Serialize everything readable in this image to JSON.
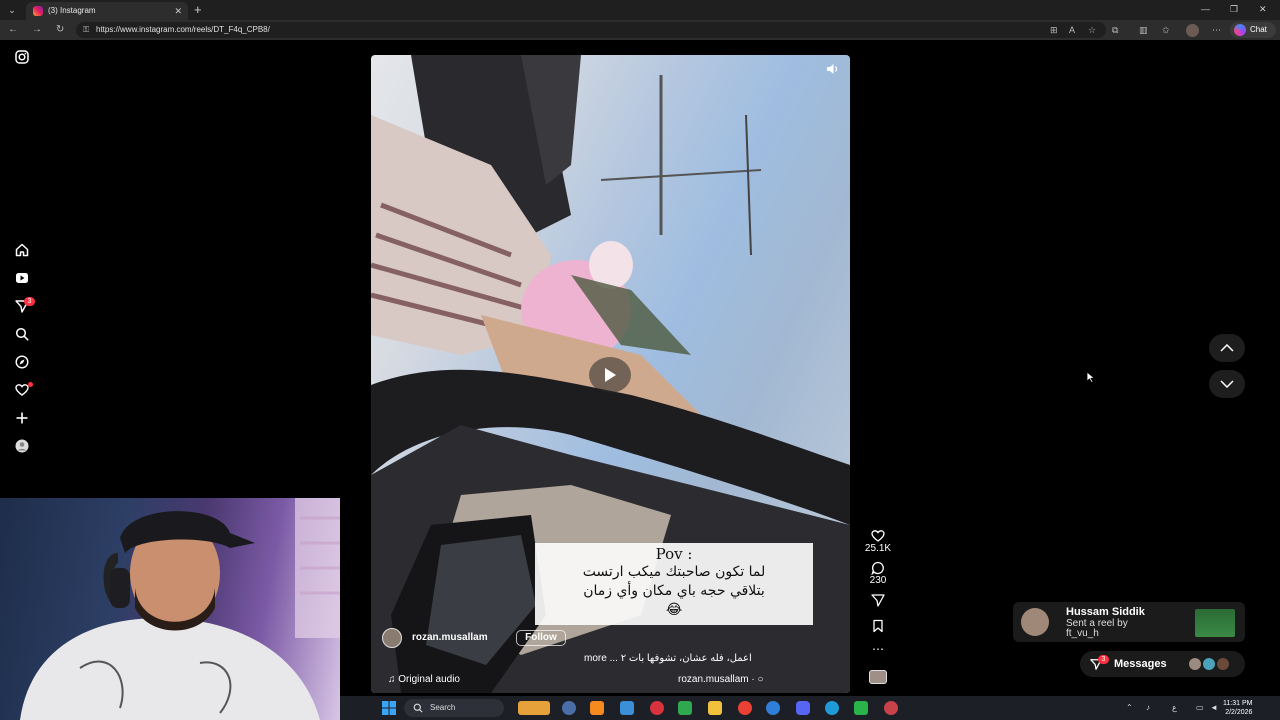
{
  "browser": {
    "tab_title": "(3) Instagram",
    "url": "https://www.instagram.com/reels/DT_F4q_CPB8/",
    "chat_label": "Chat"
  },
  "sidebar": {
    "notifications_badge": "3"
  },
  "reel": {
    "caption_pov": "Pov :",
    "caption_line1": "لما تكون صاحبتك ميكب ارتست",
    "caption_line2": "بتلاقي حجه باي مكان وأي زمان",
    "caption_emoji": "😂",
    "author": "rozan.musallam",
    "follow_label": "Follow",
    "description": "اعمل، فله عشان، تشوفها بات ٢ ... more",
    "audio_label": "♫ Original audio",
    "audio_author": "rozan.musallam · ○"
  },
  "actions": {
    "likes": "25.1K",
    "comments": "230"
  },
  "toast": {
    "name": "Hussam Siddik",
    "line1": "Sent a reel by",
    "line2": "ft_vu_h"
  },
  "messages": {
    "label": "Messages",
    "badge": "3"
  },
  "taskbar": {
    "search_placeholder": "Search",
    "time": "11:31 PM",
    "date": "2/2/2026",
    "lang": "ع"
  },
  "colors": {
    "badge_red": "#ff3040",
    "page_bg": "#000000"
  }
}
